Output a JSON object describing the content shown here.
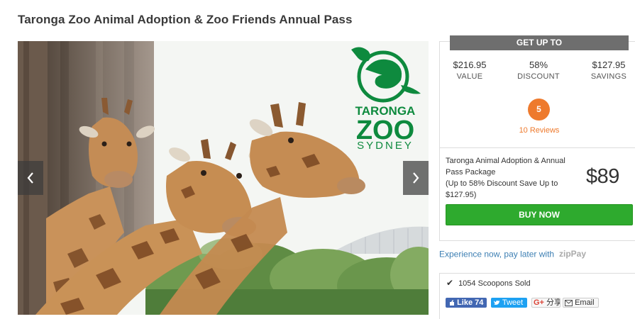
{
  "page": {
    "title": "Taronga Zoo Animal Adoption & Zoo Friends Annual Pass"
  },
  "gallery": {
    "logo_line1": "TARONGA",
    "logo_line2": "ZOO",
    "logo_line3": "SYDNEY",
    "prev_icon": "chevron-left-icon",
    "next_icon": "chevron-right-icon"
  },
  "deal": {
    "banner": "GET UP TO",
    "value_amount": "$216.95",
    "value_label": "VALUE",
    "discount_amount": "58%",
    "discount_label": "DISCOUNT",
    "savings_amount": "$127.95",
    "savings_label": "SAVINGS",
    "rating": "5",
    "reviews": "10 Reviews",
    "package_name": "Taronga Animal Adoption & Annual Pass Package",
    "package_detail": "(Up to 58% Discount Save Up to $127.95)",
    "price": "$89",
    "buy_label": "BUY NOW"
  },
  "zip": {
    "text": "Experience now, pay later with",
    "brand": "zipPay"
  },
  "social": {
    "sold": "1054 Scoopons Sold",
    "fb_label": "Like 74",
    "tw_label": "Tweet",
    "g_label": "分享",
    "email_label": "Email"
  },
  "colors": {
    "accent_orange": "#ee7a2d",
    "buy_green": "#2eaa2e",
    "zoo_green": "#0e8a3e",
    "link_blue": "#3d7fb3"
  }
}
